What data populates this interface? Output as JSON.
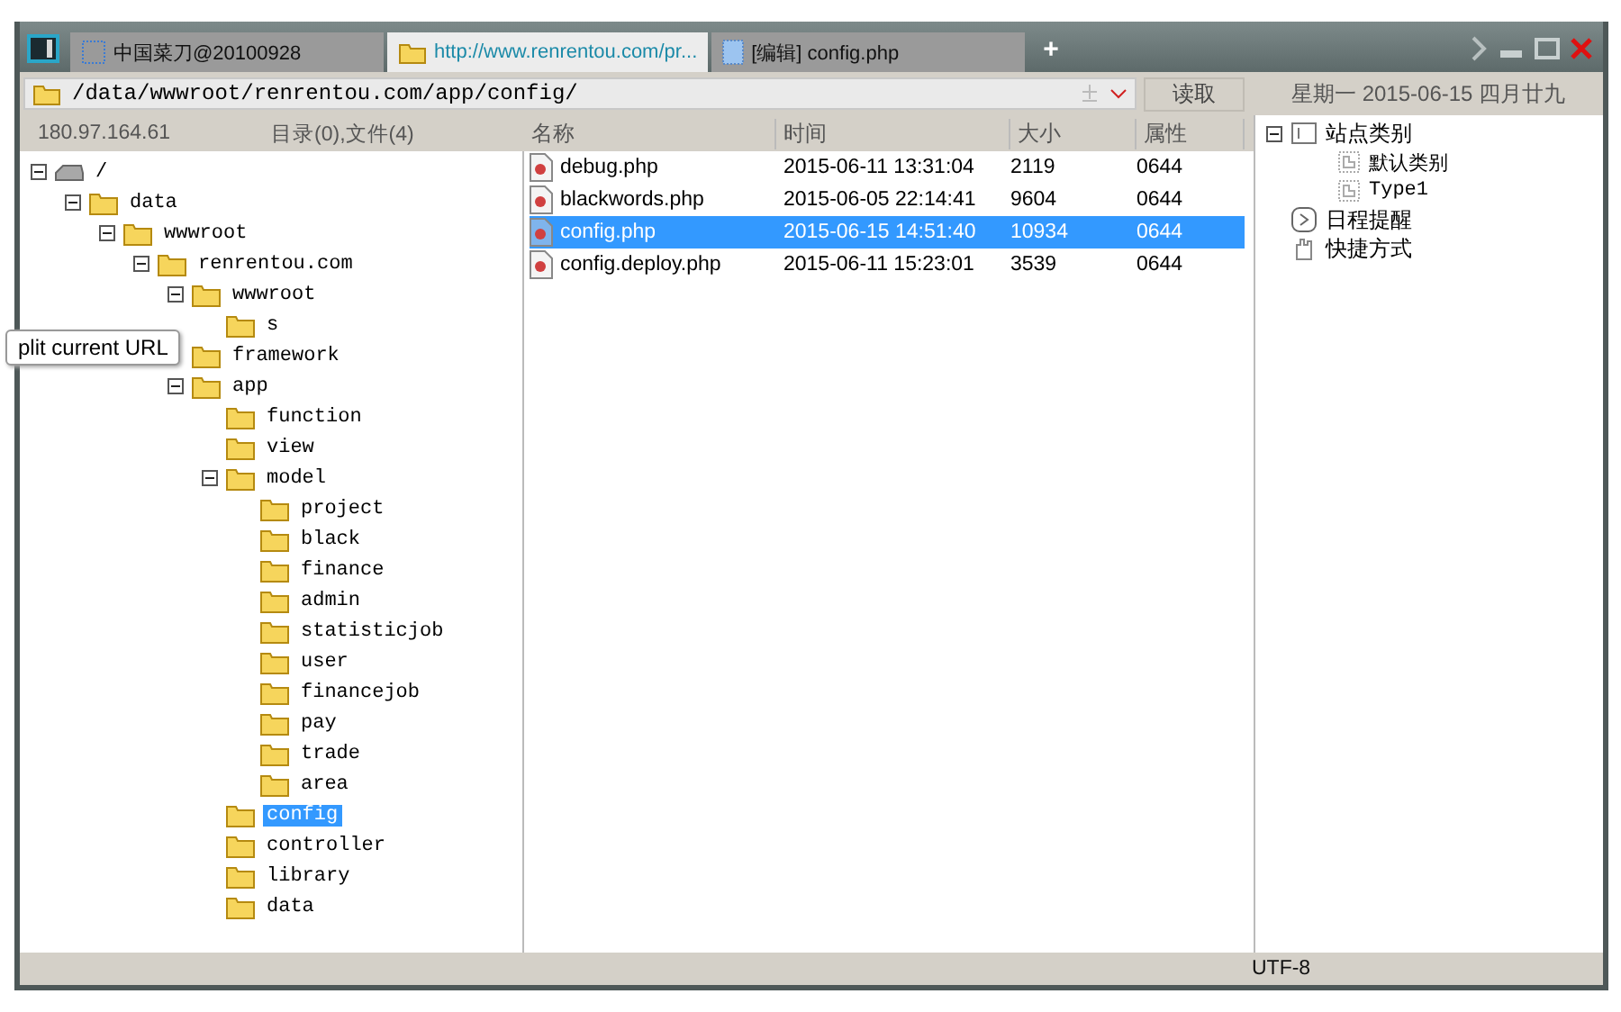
{
  "tabs": [
    {
      "label": "中国菜刀@20100928",
      "kind": "window",
      "selected": false
    },
    {
      "label": "http://www.renrentou.com/pr...",
      "kind": "folder",
      "selected": true
    },
    {
      "label": "[编辑] config.php",
      "kind": "edit",
      "selected": false
    }
  ],
  "new_tab": "+",
  "address": {
    "value": "/data/wwwroot/renrentou.com/app/config/",
    "read_button": "读取"
  },
  "date": "星期一 2015-06-15 四月廿九",
  "info": {
    "ip": "180.97.164.61",
    "counts": "目录(0),文件(4)"
  },
  "tree": [
    {
      "name": "/",
      "kind": "drive",
      "expanded": true,
      "selected": false,
      "children": [
        {
          "name": "data",
          "kind": "folder",
          "expanded": true,
          "selected": false,
          "children": [
            {
              "name": "wwwroot",
              "kind": "folder",
              "expanded": true,
              "selected": false,
              "children": [
                {
                  "name": "renrentou.com",
                  "kind": "folder",
                  "expanded": true,
                  "selected": false,
                  "children": [
                    {
                      "name": "wwwroot",
                      "kind": "folder",
                      "expanded": true,
                      "selected": false,
                      "children": [
                        {
                          "name": "s",
                          "kind": "folder",
                          "selected": false
                        }
                      ]
                    },
                    {
                      "name": "framework",
                      "kind": "folder",
                      "selected": false
                    },
                    {
                      "name": "app",
                      "kind": "folder",
                      "expanded": true,
                      "selected": false,
                      "children": [
                        {
                          "name": "function",
                          "kind": "folder",
                          "selected": false
                        },
                        {
                          "name": "view",
                          "kind": "folder",
                          "selected": false
                        },
                        {
                          "name": "model",
                          "kind": "folder",
                          "expanded": true,
                          "selected": false,
                          "children": [
                            {
                              "name": "project",
                              "kind": "folder",
                              "selected": false
                            },
                            {
                              "name": "black",
                              "kind": "folder",
                              "selected": false
                            },
                            {
                              "name": "finance",
                              "kind": "folder",
                              "selected": false
                            },
                            {
                              "name": "admin",
                              "kind": "folder",
                              "selected": false
                            },
                            {
                              "name": "statisticjob",
                              "kind": "folder",
                              "selected": false
                            },
                            {
                              "name": "user",
                              "kind": "folder",
                              "selected": false
                            },
                            {
                              "name": "financejob",
                              "kind": "folder",
                              "selected": false
                            },
                            {
                              "name": "pay",
                              "kind": "folder",
                              "selected": false
                            },
                            {
                              "name": "trade",
                              "kind": "folder",
                              "selected": false
                            },
                            {
                              "name": "area",
                              "kind": "folder",
                              "selected": false
                            }
                          ]
                        },
                        {
                          "name": "config",
                          "kind": "folder",
                          "selected": true
                        },
                        {
                          "name": "controller",
                          "kind": "folder",
                          "selected": false
                        },
                        {
                          "name": "library",
                          "kind": "folder",
                          "selected": false
                        },
                        {
                          "name": "data",
                          "kind": "folder",
                          "selected": false
                        }
                      ]
                    }
                  ]
                }
              ]
            }
          ]
        }
      ]
    }
  ],
  "tooltip": "plit current URL",
  "files": {
    "columns": [
      "名称",
      "时间",
      "大小",
      "属性"
    ],
    "rows": [
      {
        "name": "debug.php",
        "time": "2015-06-11 13:31:04",
        "size": "2119",
        "attr": "0644",
        "selected": false
      },
      {
        "name": "blackwords.php",
        "time": "2015-06-05 22:14:41",
        "size": "9604",
        "attr": "0644",
        "selected": false
      },
      {
        "name": "config.php",
        "time": "2015-06-15 14:51:40",
        "size": "10934",
        "attr": "0644",
        "selected": true
      },
      {
        "name": "config.deploy.php",
        "time": "2015-06-11 15:23:01",
        "size": "3539",
        "attr": "0644",
        "selected": false
      }
    ]
  },
  "sites": [
    {
      "name": "站点类别",
      "kind": "category",
      "expanded": true,
      "children": [
        {
          "name": "默认类别"
        },
        {
          "name": "Type1"
        }
      ]
    },
    {
      "name": "日程提醒",
      "kind": "schedule"
    },
    {
      "name": "快捷方式",
      "kind": "shortcut"
    }
  ],
  "status": "UTF-8"
}
